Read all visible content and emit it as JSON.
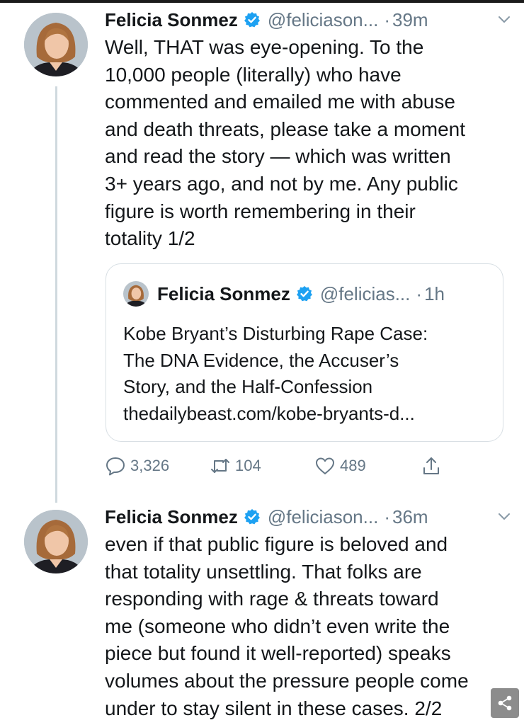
{
  "colors": {
    "verified": "#1da1f2",
    "text": "#14171a",
    "muted": "#657786",
    "border": "#d8dfe4"
  },
  "tweet1": {
    "name": "Felicia Sonmez",
    "handle": "@feliciason...",
    "dot": "·",
    "time": "39m",
    "lines": [
      "Well, THAT was eye-opening. To the",
      "10,000 people (literally) who have",
      "commented and emailed me with abuse",
      "and death threats, please take a moment",
      "and read the story — which was written",
      "3+ years ago, and not by me. Any public",
      "figure is worth remembering in their",
      "totality 1/2"
    ],
    "quote": {
      "name": "Felicia Sonmez",
      "handle": "@felicias...",
      "dot": "·",
      "time": "1h",
      "lines": [
        "Kobe Bryant’s Disturbing Rape Case:",
        "The DNA Evidence, the Accuser’s",
        "Story, and the Half-Confession",
        "thedailybeast.com/kobe-bryants-d..."
      ]
    },
    "actions": {
      "replies": "3,326",
      "retweets": "104",
      "likes": "489"
    }
  },
  "tweet2": {
    "name": "Felicia Sonmez",
    "handle": "@feliciason...",
    "dot": "·",
    "time": "36m",
    "lines": [
      "even if that public figure is beloved and",
      "that totality unsettling. That folks are",
      "responding with rage & threats toward",
      "me (someone who didn’t even write the",
      "piece but found it well-reported) speaks",
      "volumes about the pressure people come",
      "under to stay silent in these cases. 2/2"
    ]
  },
  "icons": {
    "verified": "verified-badge-icon",
    "caret": "chevron-down-icon",
    "reply": "reply-icon",
    "retweet": "retweet-icon",
    "like": "heart-icon",
    "share": "share-icon",
    "fab": "share-nodes-icon"
  }
}
